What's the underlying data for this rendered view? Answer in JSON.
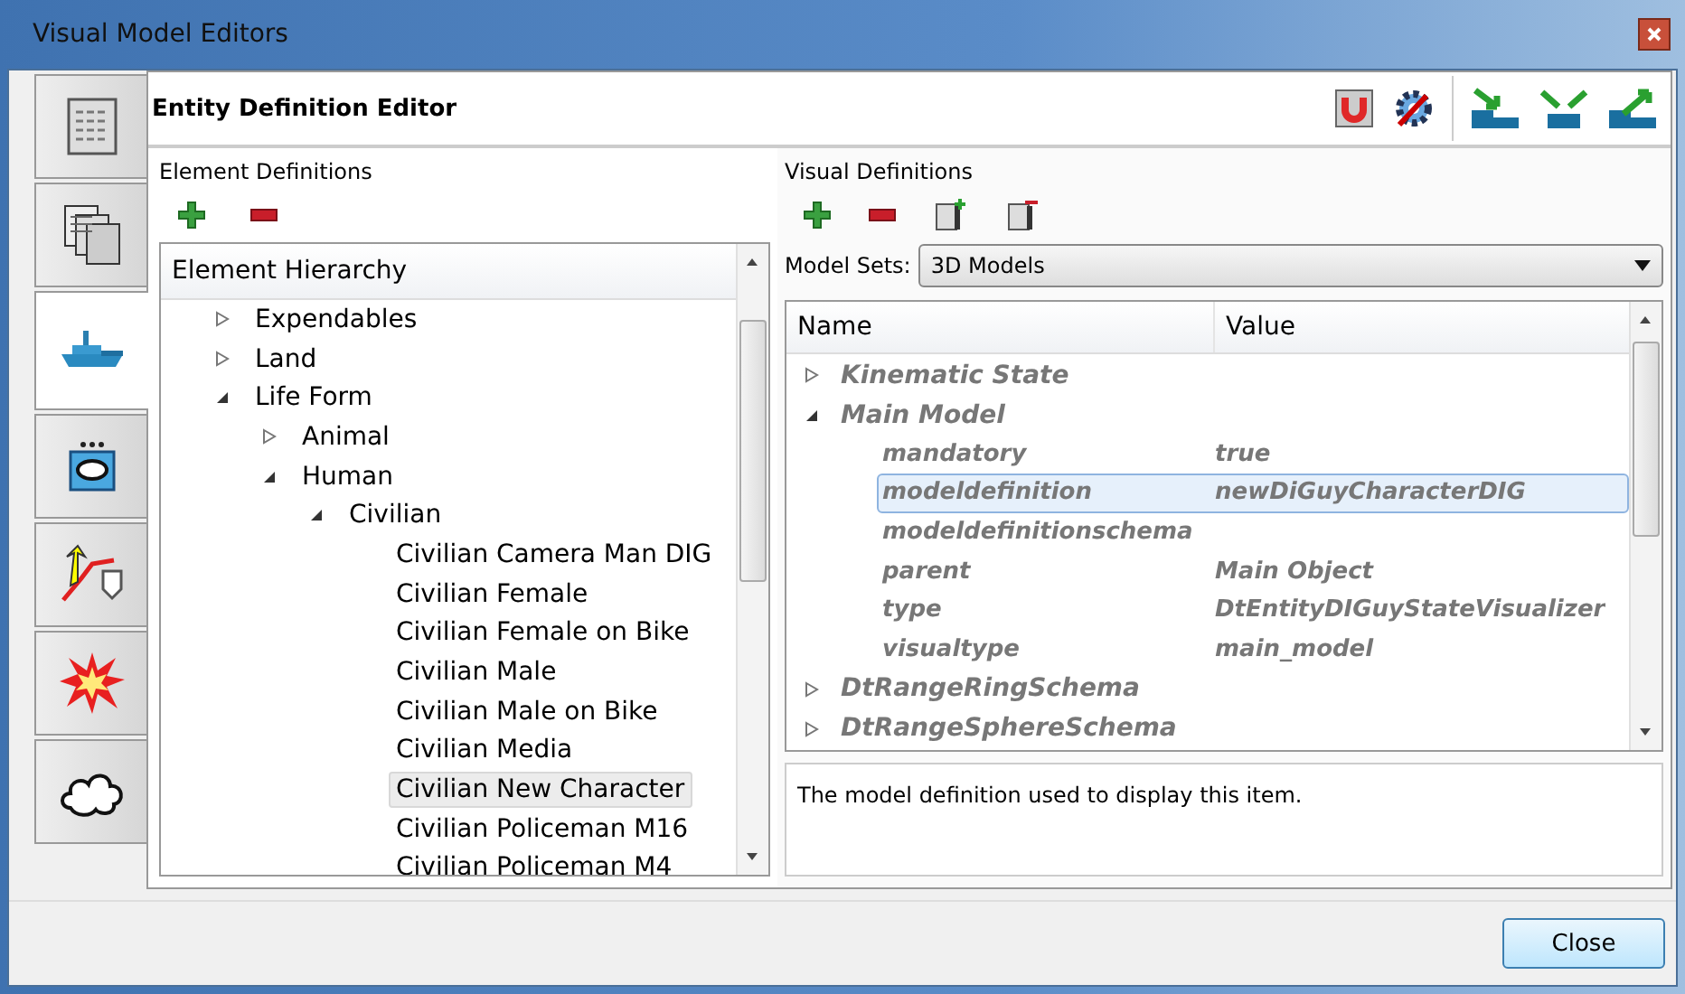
{
  "window": {
    "title": "Visual Model Editors"
  },
  "side_tabs": [
    {
      "selected": false
    },
    {
      "selected": false
    },
    {
      "selected": true
    },
    {
      "selected": false
    },
    {
      "selected": false
    },
    {
      "selected": false
    },
    {
      "selected": false
    }
  ],
  "editor": {
    "title": "Entity Definition Editor"
  },
  "element_definitions": {
    "label": "Element Definitions",
    "tree": {
      "header": "Element Hierarchy",
      "items": [
        {
          "label": "Expendables",
          "expanded": false,
          "selected": false
        },
        {
          "label": "Land",
          "expanded": false,
          "selected": false
        },
        {
          "label": "Life Form",
          "expanded": true,
          "selected": false,
          "children": [
            {
              "label": "Animal",
              "expanded": false,
              "selected": false
            },
            {
              "label": "Human",
              "expanded": true,
              "selected": false,
              "children": [
                {
                  "label": "Civilian",
                  "expanded": true,
                  "selected": false,
                  "children": [
                    {
                      "label": "Civilian Camera Man DIG",
                      "selected": false
                    },
                    {
                      "label": "Civilian Female",
                      "selected": false
                    },
                    {
                      "label": "Civilian Female on Bike",
                      "selected": false
                    },
                    {
                      "label": "Civilian Male",
                      "selected": false
                    },
                    {
                      "label": "Civilian Male on Bike",
                      "selected": false
                    },
                    {
                      "label": "Civilian Media",
                      "selected": false
                    },
                    {
                      "label": "Civilian New Character",
                      "selected": true
                    },
                    {
                      "label": "Civilian Policeman M16",
                      "selected": false
                    },
                    {
                      "label": "Civilian Policeman M4",
                      "selected": false
                    }
                  ]
                }
              ]
            }
          ]
        }
      ]
    }
  },
  "visual_definitions": {
    "label": "Visual Definitions",
    "model_sets": {
      "label": "Model Sets:",
      "value": "3D Models"
    },
    "grid": {
      "columns": [
        "Name",
        "Value"
      ],
      "categories": [
        {
          "name": "Kinematic State",
          "expanded": false
        },
        {
          "name": "Main Model",
          "expanded": true,
          "properties": [
            {
              "name": "mandatory",
              "value": "true",
              "selected": false
            },
            {
              "name": "modeldefinition",
              "value": "newDiGuyCharacterDIG",
              "selected": true
            },
            {
              "name": "modeldefinitionschema",
              "selected": false
            },
            {
              "name": "parent",
              "value": "Main Object",
              "selected": false
            },
            {
              "name": "type",
              "value": "DtEntityDIGuyStateVisualizer",
              "selected": false
            },
            {
              "name": "visualtype",
              "value": "main_model",
              "selected": false
            }
          ]
        },
        {
          "name": "DtRangeRingSchema",
          "expanded": false
        },
        {
          "name": "DtRangeSphereSchema",
          "expanded": false
        }
      ]
    },
    "description": "The model definition used to display this item."
  },
  "buttons": {
    "close": "Close"
  }
}
